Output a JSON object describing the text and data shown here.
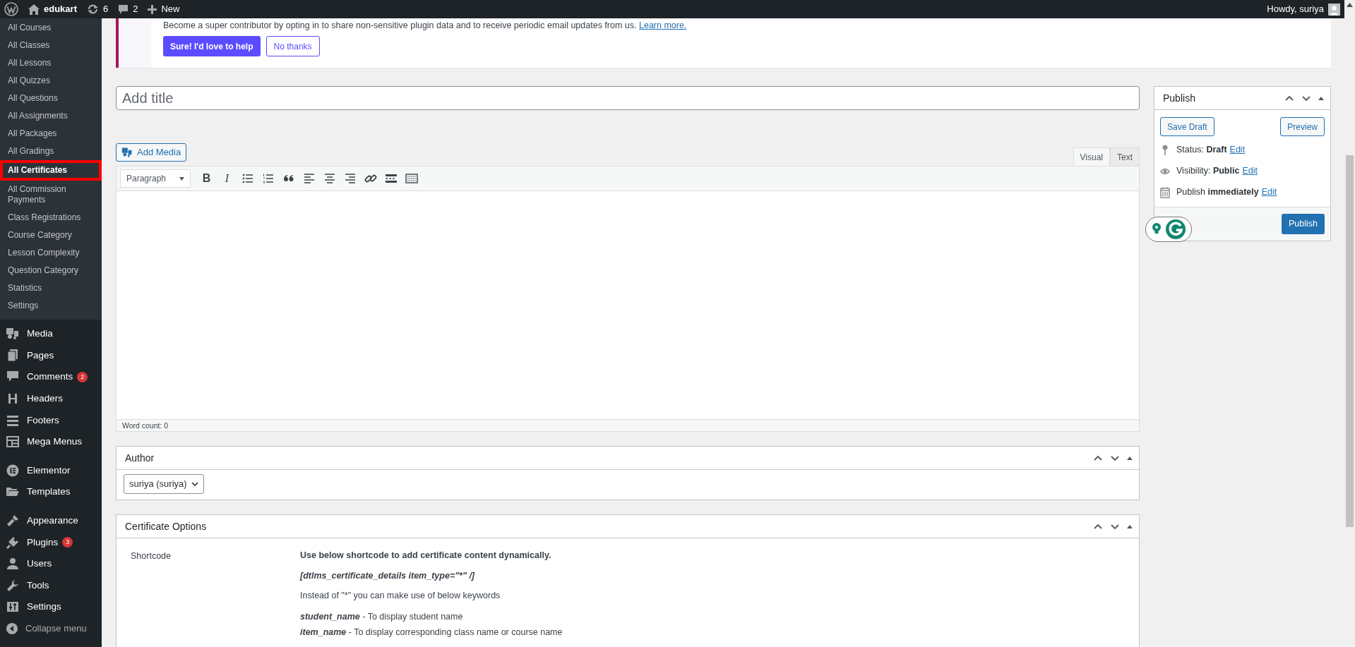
{
  "admin_bar": {
    "site_name": "edukart",
    "updates": "6",
    "comments": "2",
    "new_label": "New",
    "greeting": "Howdy, suriya"
  },
  "sidebar": {
    "submenu": [
      {
        "label": "All Courses",
        "selected": false
      },
      {
        "label": "All Classes",
        "selected": false
      },
      {
        "label": "All Lessons",
        "selected": false
      },
      {
        "label": "All Quizzes",
        "selected": false
      },
      {
        "label": "All Questions",
        "selected": false
      },
      {
        "label": "All Assignments",
        "selected": false
      },
      {
        "label": "All Packages",
        "selected": false
      },
      {
        "label": "All Gradings",
        "selected": false
      },
      {
        "label": "All Certificates",
        "selected": true
      },
      {
        "label": "All Commission Payments",
        "selected": false
      },
      {
        "label": "Class Registrations",
        "selected": false
      },
      {
        "label": "Course Category",
        "selected": false
      },
      {
        "label": "Lesson Complexity",
        "selected": false
      },
      {
        "label": "Question Category",
        "selected": false
      },
      {
        "label": "Statistics",
        "selected": false
      },
      {
        "label": "Settings",
        "selected": false
      }
    ],
    "menu_groups": [
      [
        {
          "label": "Media"
        },
        {
          "label": "Pages"
        },
        {
          "label": "Comments",
          "badge": "2"
        },
        {
          "label": "Headers"
        },
        {
          "label": "Footers"
        },
        {
          "label": "Mega Menus"
        }
      ],
      [
        {
          "label": "Elementor"
        },
        {
          "label": "Templates"
        }
      ],
      [
        {
          "label": "Appearance"
        },
        {
          "label": "Plugins",
          "badge": "3"
        },
        {
          "label": "Users"
        },
        {
          "label": "Tools"
        },
        {
          "label": "Settings"
        }
      ]
    ],
    "collapse_label": "Collapse menu"
  },
  "notice": {
    "text": "Become a super contributor by opting in to share non-sensitive plugin data and to receive periodic email updates from us.",
    "link": "Learn more.",
    "primary_button": "Sure! I'd love to help",
    "secondary_button": "No thanks"
  },
  "title_field": {
    "placeholder": "Add title"
  },
  "editor": {
    "add_media": "Add Media",
    "tabs": [
      {
        "label": "Visual",
        "selected": true
      },
      {
        "label": "Text",
        "selected": false
      }
    ],
    "format": "Paragraph",
    "toolbar": [
      {
        "kind": "bold",
        "label": "B"
      },
      {
        "kind": "italic",
        "label": "I"
      },
      {
        "kind": "bullets"
      },
      {
        "kind": "numbers"
      },
      {
        "kind": "quote"
      },
      {
        "kind": "align-left"
      },
      {
        "kind": "align-center"
      },
      {
        "kind": "align-right"
      },
      {
        "kind": "link"
      },
      {
        "kind": "more"
      },
      {
        "kind": "toggle"
      }
    ],
    "word_count": "Word count: 0"
  },
  "author_box": {
    "title": "Author",
    "author": "suriya (suriya)"
  },
  "certificate_box": {
    "title": "Certificate Options",
    "field_label": "Shortcode",
    "lines": [
      {
        "kind": "heading",
        "text": "Use below shortcode to add certificate content dynamically."
      },
      {
        "kind": "code",
        "text": "[dtlms_certificate_details item_type=\"*\" /]"
      },
      {
        "kind": "text",
        "text": "Instead of \"*\" you can make use of below keywords"
      },
      {
        "kind": "keyword",
        "keyword": "student_name",
        "text": "- To display student name"
      },
      {
        "kind": "keyword",
        "keyword": "item_name",
        "text": "- To display corresponding class name or course name"
      }
    ]
  },
  "publish_box": {
    "title": "Publish",
    "save_draft": "Save Draft",
    "preview": "Preview",
    "rows": [
      {
        "label": "Status: **Draft**",
        "link": "Edit"
      },
      {
        "label": "Visibility: **Public**",
        "link": "Edit"
      },
      {
        "label": "Publish **immediately**",
        "link": "Edit"
      }
    ],
    "publish_button": "Publish"
  }
}
